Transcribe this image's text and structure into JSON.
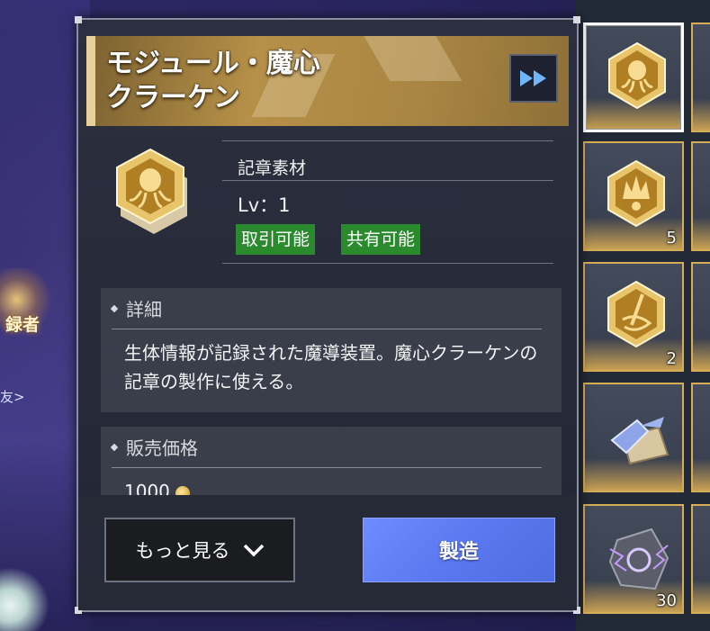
{
  "background": {
    "left_text": "録者",
    "left_link": "友>"
  },
  "panel": {
    "title_line1": "モジュール・魔心",
    "title_line2": "クラーケン",
    "category": "記章素材",
    "level": "Lv：1",
    "tags": [
      "取引可能",
      "共有可能"
    ],
    "detail_heading": "詳細",
    "description": "生体情報が記録された魔導装置。魔心クラーケンの記章の製作に使える。",
    "price_heading": "販売価格",
    "price_value": "1000",
    "more_button": "もっと見る",
    "craft_button": "製造"
  },
  "inventory": {
    "slots": [
      {
        "item": "kraken-module",
        "count": "",
        "selected": true
      },
      {
        "item": "crown-module",
        "count": "5",
        "selected": false
      },
      {
        "item": "sword-module",
        "count": "2",
        "selected": false
      },
      {
        "item": "crystal-scroll",
        "count": "",
        "selected": false
      },
      {
        "item": "lightning-stone",
        "count": "30",
        "selected": false
      }
    ]
  },
  "colors": {
    "accent_gold": "#d6ad56",
    "tag_green": "#2b8a2e",
    "craft_blue": "#5b78f0"
  }
}
